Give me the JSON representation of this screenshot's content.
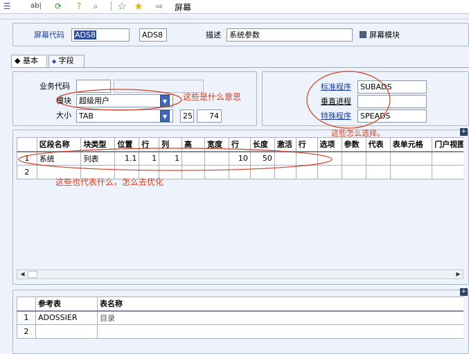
{
  "toolbar": {
    "title": "屏幕",
    "icons": [
      "list-icon",
      "text-field-icon",
      "refresh-icon",
      "help-icon",
      "search-icon",
      "favorite-add-icon",
      "favorite-icon",
      "signpost-icon"
    ]
  },
  "header": {
    "screen_code_label": "屏幕代码",
    "screen_code_value": "ADS8",
    "screen_code_value2": "ADS8",
    "desc_label": "描述",
    "desc_value": "系统参数",
    "screen_module_label": "屏幕模块",
    "screen_module_checked": true
  },
  "tabs": [
    {
      "label": "基本",
      "active": true
    },
    {
      "label": "字段",
      "active": false
    }
  ],
  "basic": {
    "business_code_label": "业务代码",
    "business_code_value": "",
    "module_label": "模块",
    "module_value": "超级用户",
    "size_label": "大小",
    "size_value": "TAB",
    "size_w": "25",
    "size_h": "74",
    "std_program_label": "标准程序",
    "std_program_value": "SUBADS",
    "vertical_process_label": "垂直进程",
    "vertical_process_value": "",
    "special_program_label": "特殊程序",
    "special_program_value": "SPEADS"
  },
  "grid1": {
    "headers": [
      "",
      "区段名称",
      "块类型",
      "位置",
      "行",
      "列",
      "高",
      "宽度",
      "行",
      "长度",
      "激活",
      "行",
      "选项",
      "参数",
      "代表",
      "表单元格",
      "门户视图"
    ],
    "rows": [
      [
        "1",
        "系统",
        "列表",
        "1.1",
        "1",
        "1",
        "",
        "",
        "10",
        "50",
        "",
        "",
        "",
        "",
        "",
        "",
        ""
      ],
      [
        "2",
        "",
        "",
        "",
        "",
        "",
        "",
        "",
        "",
        "",
        "",
        "",
        "",
        "",
        "",
        "",
        ""
      ]
    ]
  },
  "grid2": {
    "headers": [
      "",
      "参考表",
      "表名称"
    ],
    "rows": [
      [
        "1",
        "ADOSSIER",
        "目录"
      ],
      [
        "2",
        "",
        ""
      ]
    ]
  },
  "annotations": {
    "module_note": "这些是什么意思",
    "program_note": "这些怎么选择。",
    "grid_note": "这些也代表什么，怎么去优化"
  },
  "colors": {
    "annotation_red": "#d04020",
    "link_blue": "#1a3fb0",
    "panel_bg": "#eef3fb"
  }
}
